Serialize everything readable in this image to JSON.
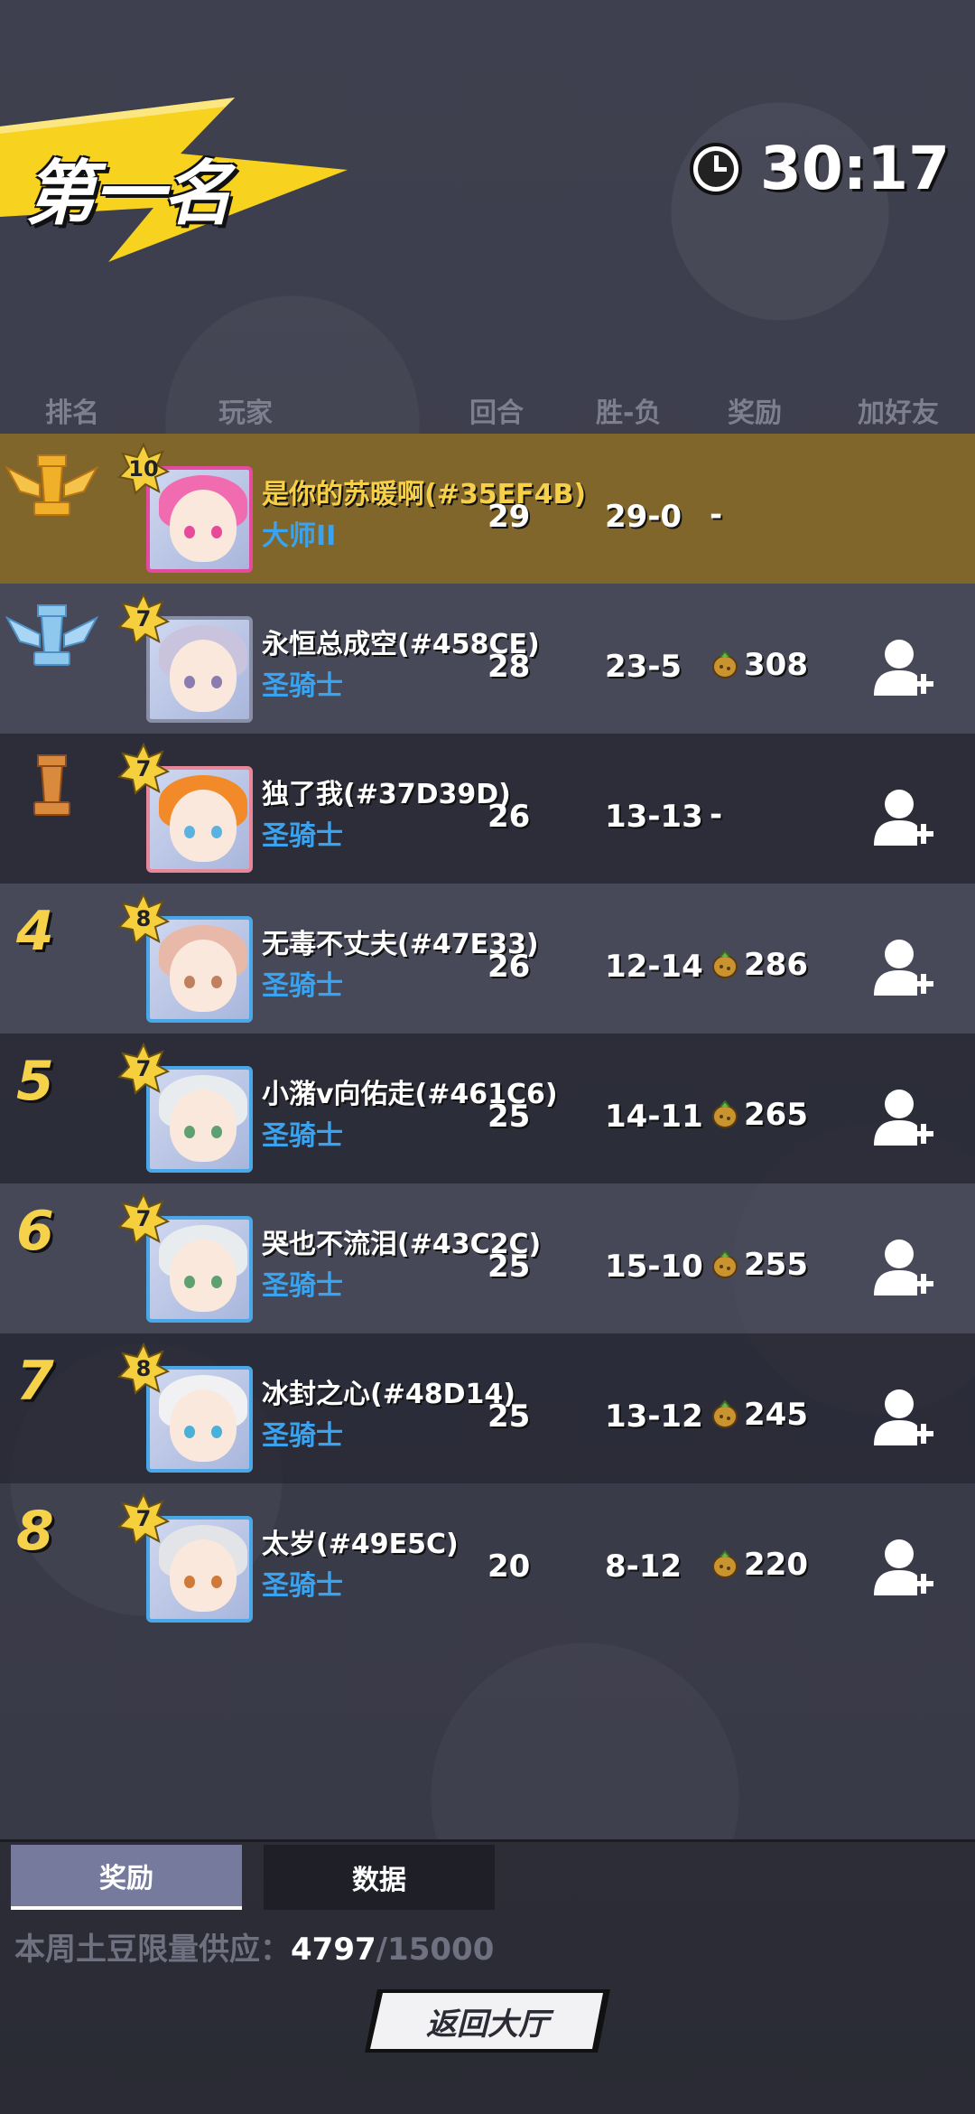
{
  "header": {
    "title": "第一名",
    "timer": "30:17"
  },
  "columns": {
    "rank": "排名",
    "player": "玩家",
    "round": "回合",
    "win_loss": "胜-负",
    "reward": "奖励",
    "add_friend": "加好友"
  },
  "rows": [
    {
      "rank": "1",
      "trophy": "gold",
      "level": "10",
      "name": "是你的苏暖啊(#35EF4B)",
      "title": "大师II",
      "round": "29",
      "wl": "29-0",
      "reward": "-",
      "add_friend": false,
      "hair": "#f06bb0",
      "eye": "#e84a9a"
    },
    {
      "rank": "2",
      "trophy": "silver",
      "level": "7",
      "name": "永恒总成空(#458CE)",
      "title": "圣骑士",
      "round": "28",
      "wl": "23-5",
      "reward": "308",
      "add_friend": true,
      "hair": "#c9c3dd",
      "eye": "#8a7bb0"
    },
    {
      "rank": "3",
      "trophy": "bronze",
      "level": "7",
      "name": "独了我(#37D39D)",
      "title": "圣骑士",
      "round": "26",
      "wl": "13-13",
      "reward": "-",
      "add_friend": true,
      "hair": "#f28a2a",
      "eye": "#5ab2e0"
    },
    {
      "rank": "4",
      "trophy": "",
      "level": "8",
      "name": "无毒不丈夫(#47E33)",
      "title": "圣骑士",
      "round": "26",
      "wl": "12-14",
      "reward": "286",
      "add_friend": true,
      "hair": "#e8b8a8",
      "eye": "#c08060"
    },
    {
      "rank": "5",
      "trophy": "",
      "level": "7",
      "name": "小潴v向佑走(#461C6)",
      "title": "圣骑士",
      "round": "25",
      "wl": "14-11",
      "reward": "265",
      "add_friend": true,
      "hair": "#e9ecef",
      "eye": "#5fa070"
    },
    {
      "rank": "6",
      "trophy": "",
      "level": "7",
      "name": "哭也不流泪(#43C2C)",
      "title": "圣骑士",
      "round": "25",
      "wl": "15-10",
      "reward": "255",
      "add_friend": true,
      "hair": "#e9ecef",
      "eye": "#5fa070"
    },
    {
      "rank": "7",
      "trophy": "",
      "level": "8",
      "name": "冰封之心(#48D14)",
      "title": "圣骑士",
      "round": "25",
      "wl": "13-12",
      "reward": "245",
      "add_friend": true,
      "hair": "#f1f1f4",
      "eye": "#4ab0d8"
    },
    {
      "rank": "8",
      "trophy": "",
      "level": "7",
      "name": "太岁(#49E5C)",
      "title": "圣骑士",
      "round": "20",
      "wl": "8-12",
      "reward": "220",
      "add_friend": true,
      "hair": "#e2e4e8",
      "eye": "#d07a3a"
    }
  ],
  "tabs": {
    "reward": "奖励",
    "data": "数据"
  },
  "supply": {
    "label": "本周土豆限量供应：",
    "current": "4797",
    "total": "/15000"
  },
  "back_button": "返回大厅",
  "colors": {
    "first_row": "#80662a",
    "gold_text": "#f6d24a",
    "title_blue": "#3aa3f0"
  }
}
